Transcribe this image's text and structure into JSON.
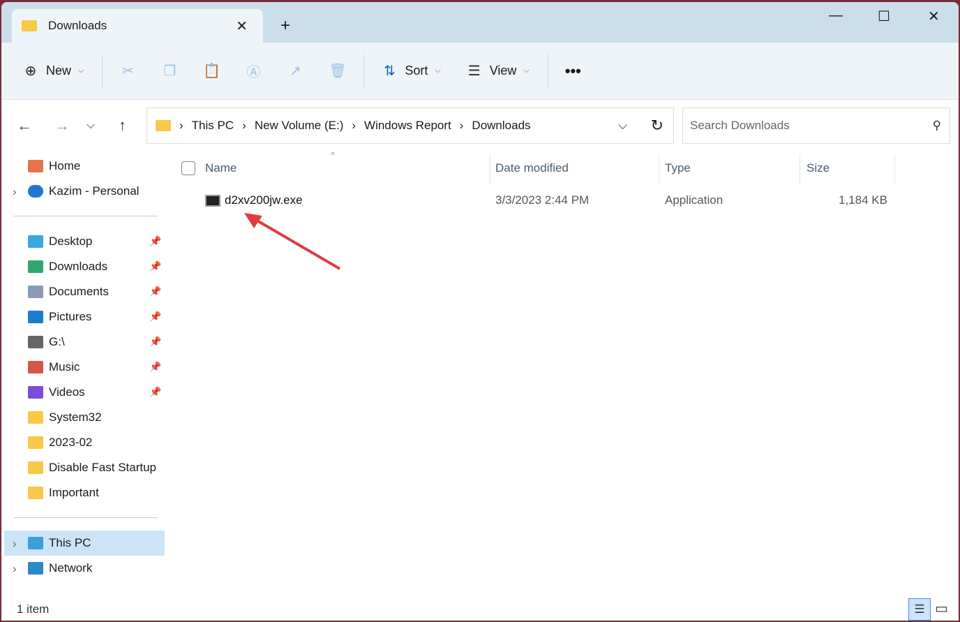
{
  "tab": {
    "title": "Downloads"
  },
  "toolbar": {
    "new": "New",
    "sort": "Sort",
    "view": "View"
  },
  "address": {
    "crumbs": [
      "This PC",
      "New Volume (E:)",
      "Windows Report",
      "Downloads"
    ]
  },
  "search": {
    "placeholder": "Search Downloads"
  },
  "sidebar": {
    "top": [
      "Home",
      "Kazim - Personal"
    ],
    "quick": [
      "Desktop",
      "Downloads",
      "Documents",
      "Pictures",
      "G:\\",
      "Music",
      "Videos",
      "System32",
      "2023-02",
      "Disable Fast Startup",
      "Important"
    ],
    "bottom": [
      "This PC",
      "Network"
    ]
  },
  "columns": [
    "Name",
    "Date modified",
    "Type",
    "Size"
  ],
  "files": [
    {
      "name": "d2xv200jw.exe",
      "date": "3/3/2023 2:44 PM",
      "type": "Application",
      "size": "1,184 KB"
    }
  ],
  "status": "1 item",
  "colors": {
    "accent": "#0067c0",
    "arrow": "#e23c3c"
  }
}
